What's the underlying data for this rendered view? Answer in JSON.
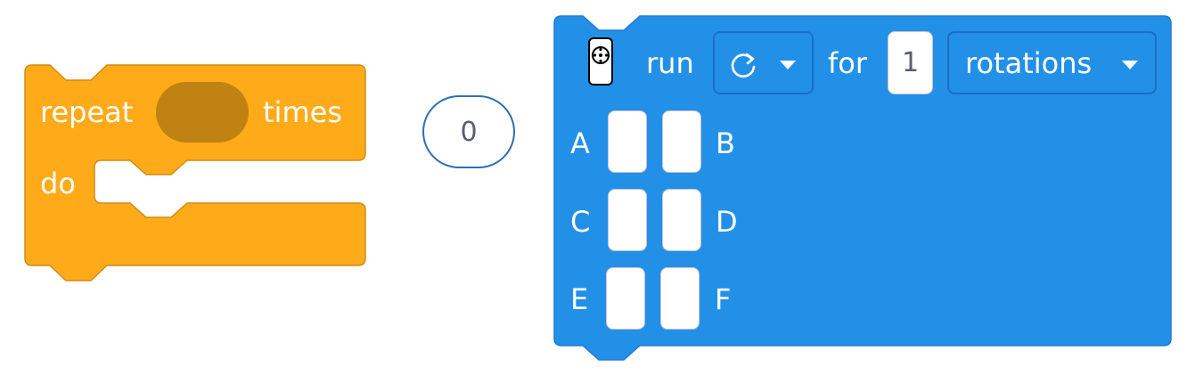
{
  "repeat_block": {
    "label_repeat": "repeat",
    "label_times": "times",
    "label_do": "do",
    "color": "#ffab19",
    "slot_color": "#c08212"
  },
  "number_reporter": {
    "value": "0"
  },
  "motor_block": {
    "color": "#2390e8",
    "hub_icon": "hub-icon",
    "label_run": "run",
    "direction_icon": "clockwise-arrow-icon",
    "label_for": "for",
    "count": "1",
    "unit": "rotations",
    "ports": [
      "A",
      "B",
      "C",
      "D",
      "E",
      "F"
    ]
  }
}
